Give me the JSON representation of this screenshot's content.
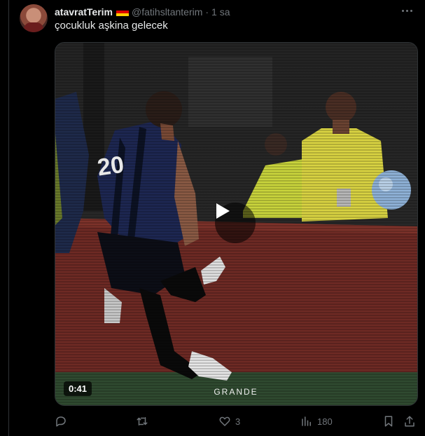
{
  "tweet": {
    "display_name": "atavratTerim",
    "handle": "@fatihsltanterim",
    "separator": "·",
    "time": "1 sa",
    "text": "çocukluk aşkina gelecek"
  },
  "video": {
    "duration": "0:41",
    "watermark": "GRANDE",
    "jersey_number": "20"
  },
  "actions": {
    "reply_count": "",
    "retweet_count": "",
    "like_count": "3",
    "views_count": "180"
  },
  "colors": {
    "background": "#000000",
    "text_primary": "#e7e9ea",
    "text_secondary": "#71767b",
    "border": "#2f3336"
  },
  "icons": [
    "more-icon",
    "reply-icon",
    "retweet-icon",
    "like-icon",
    "views-icon",
    "bookmark-icon",
    "share-icon",
    "play-icon"
  ]
}
